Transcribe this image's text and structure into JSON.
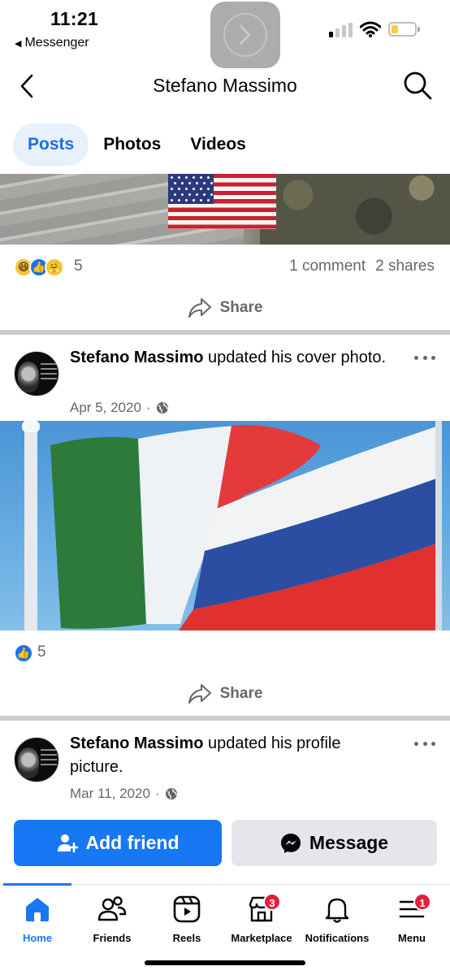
{
  "status_bar": {
    "time": "11:21",
    "back_app": "Messenger"
  },
  "header": {
    "title": "Stefano Massimo"
  },
  "tabs": [
    {
      "label": "Posts",
      "active": true
    },
    {
      "label": "Photos",
      "active": false
    },
    {
      "label": "Videos",
      "active": false
    }
  ],
  "post_top": {
    "reaction_count": "5",
    "comments": "1 comment",
    "shares": "2 shares",
    "share_label": "Share"
  },
  "post_cover": {
    "author": "Stefano Massimo",
    "action": " updated his cover photo.",
    "date": "Apr 5, 2020",
    "reaction_count": "5",
    "share_label": "Share"
  },
  "post_profile": {
    "author": "Stefano Massimo",
    "action": " updated his profile picture.",
    "date": "Mar 11, 2020"
  },
  "actions": {
    "add_friend": "Add friend",
    "message": "Message"
  },
  "tabbar": {
    "items": [
      {
        "label": "Home",
        "icon": "home-icon",
        "active": true
      },
      {
        "label": "Friends",
        "icon": "friends-icon"
      },
      {
        "label": "Reels",
        "icon": "reels-icon"
      },
      {
        "label": "Marketplace",
        "icon": "marketplace-icon",
        "badge": "3"
      },
      {
        "label": "Notifications",
        "icon": "bell-icon"
      },
      {
        "label": "Menu",
        "icon": "menu-icon",
        "badge": "1"
      }
    ]
  },
  "colors": {
    "accent": "#1877f2",
    "badge": "#e41e3f",
    "secondary_text": "#65676b"
  }
}
